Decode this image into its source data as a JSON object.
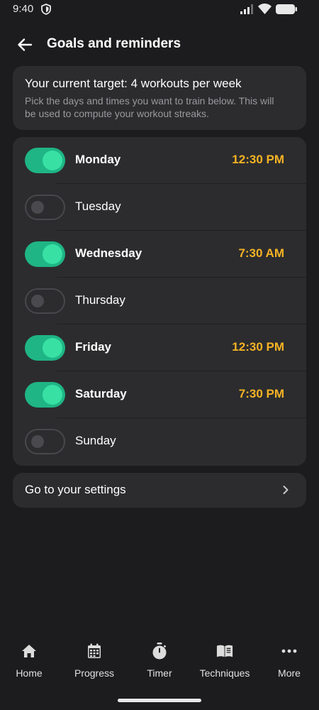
{
  "status_bar": {
    "time": "9:40",
    "icons": [
      "shield-icon",
      "signal-icon",
      "wifi-icon",
      "battery-icon"
    ]
  },
  "header": {
    "title": "Goals and reminders",
    "back_icon": "arrow-left-icon"
  },
  "target": {
    "title": "Your current target: 4 workouts per week",
    "description": "Pick the days and times you want to train below. This will be used to compute your workout streaks."
  },
  "days": [
    {
      "label": "Monday",
      "enabled": true,
      "time": "12:30 PM"
    },
    {
      "label": "Tuesday",
      "enabled": false,
      "time": ""
    },
    {
      "label": "Wednesday",
      "enabled": true,
      "time": "7:30 AM"
    },
    {
      "label": "Thursday",
      "enabled": false,
      "time": ""
    },
    {
      "label": "Friday",
      "enabled": true,
      "time": "12:30 PM"
    },
    {
      "label": "Saturday",
      "enabled": true,
      "time": "7:30 PM"
    },
    {
      "label": "Sunday",
      "enabled": false,
      "time": ""
    }
  ],
  "settings_link": {
    "label": "Go to your settings",
    "icon": "chevron-right-icon"
  },
  "nav": {
    "items": [
      {
        "label": "Home",
        "icon": "home-icon"
      },
      {
        "label": "Progress",
        "icon": "calendar-icon"
      },
      {
        "label": "Timer",
        "icon": "stopwatch-icon"
      },
      {
        "label": "Techniques",
        "icon": "book-icon"
      },
      {
        "label": "More",
        "icon": "more-dots-icon"
      }
    ]
  },
  "colors": {
    "background": "#1c1c1e",
    "card": "#2c2c2e",
    "toggle_on": "#1fb585",
    "toggle_knob_on": "#38e0a4",
    "time_accent": "#f5b324",
    "muted_text": "#9a9a9e"
  }
}
